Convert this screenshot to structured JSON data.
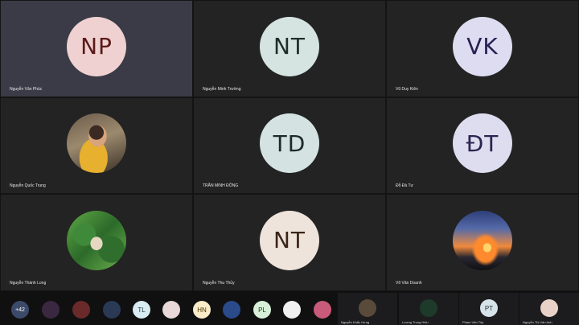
{
  "meeting": {
    "tiles": [
      {
        "name": "Nguyễn Văn Phúc",
        "initials": "NP",
        "avatar_bg": "#f0d1d1",
        "avatar_fg": "#5a1a1a",
        "active": true
      },
      {
        "name": "Nguyễn Minh Trường",
        "initials": "NT",
        "avatar_bg": "#d5e4e0",
        "avatar_fg": "#1e2d2a",
        "active": false
      },
      {
        "name": "Vũ Duy Kiên",
        "initials": "VK",
        "avatar_bg": "#dedcf0",
        "avatar_fg": "#262055",
        "active": false
      },
      {
        "name": "Nguyễn Quốc Trung",
        "initials": "",
        "avatar_bg": "",
        "avatar_fg": "",
        "photo": "photo-man",
        "active": false
      },
      {
        "name": "TRẦN MINH ĐÔNG",
        "initials": "TD",
        "avatar_bg": "#d5e2e2",
        "avatar_fg": "#1c2a2a",
        "active": false
      },
      {
        "name": "Đỗ Đà Tư",
        "initials": "ĐT",
        "avatar_bg": "#dedcef",
        "avatar_fg": "#2a2450",
        "active": false
      },
      {
        "name": "Nguyễn Thành Long",
        "initials": "",
        "avatar_bg": "",
        "avatar_fg": "",
        "photo": "photo-bottle",
        "active": false
      },
      {
        "name": "Nguyễn Thu Thủy",
        "initials": "NT",
        "avatar_bg": "#efe4db",
        "avatar_fg": "#3a2418",
        "active": false
      },
      {
        "name": "Võ Văn Doanh",
        "initials": "",
        "avatar_bg": "",
        "avatar_fg": "",
        "photo": "photo-sunset",
        "active": false
      }
    ],
    "strip": {
      "more_count": "+42",
      "chips": [
        {
          "label": "",
          "bg": "#3a2840"
        },
        {
          "label": "",
          "bg": "#6a2a2a"
        },
        {
          "label": "",
          "bg": "#2a3a55"
        },
        {
          "label": "TL",
          "bg": "#d8ecf2",
          "fg": "#1c3440"
        },
        {
          "label": "",
          "bg": "#e8d8d8"
        },
        {
          "label": "HN",
          "bg": "#fbecc8",
          "fg": "#4a3400"
        },
        {
          "label": "",
          "bg": "#2a4a8a"
        },
        {
          "label": "PL",
          "bg": "#d8f0d8",
          "fg": "#1c3a1c"
        },
        {
          "label": "",
          "bg": "#f0f0f0"
        },
        {
          "label": "",
          "bg": "#c85a7a"
        }
      ],
      "tiles": [
        {
          "name": "Nguyễn Khắc Hưng",
          "initials": "",
          "bg": "#5a4a3a"
        },
        {
          "name": "Lương Trung Hiếu",
          "initials": "",
          "bg": "#1e3a2a"
        },
        {
          "name": "Phạm Văn Tây",
          "initials": "PT",
          "bg": "#d6e3e8",
          "fg": "#22323a"
        },
        {
          "name": "Nguyễn Thị Vân Anh",
          "initials": "",
          "bg": "#e8d2c8"
        }
      ]
    }
  }
}
